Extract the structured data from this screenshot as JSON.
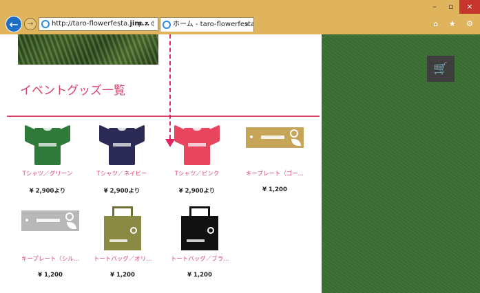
{
  "browser": {
    "address_url_prefix": "http://taro-flowerfesta.",
    "address_url_host": "jim...",
    "address_controls": "ρ ▾ ¢",
    "tab_title": "ホーム - taro-flowerfesta ...",
    "tab_close": "×",
    "back_icon": "arrow-left-icon",
    "window_minimize": "–",
    "window_restore": "▫",
    "window_close": "×",
    "toolbar_icons": "⌂ ★ ⚙"
  },
  "page": {
    "section_title": "イベントグッズ一覧",
    "accent_color": "#d9406a",
    "sidebar_color": "#3b6e34",
    "cart_icon": "cart-icon"
  },
  "products": [
    {
      "name": "Tシャツ／グリーン",
      "price": "¥ 2,900より",
      "kind": "tshirt",
      "color": "#2f7a3a"
    },
    {
      "name": "Tシャツ／ネイビー",
      "price": "¥ 2,900より",
      "kind": "tshirt",
      "color": "#2b2a55"
    },
    {
      "name": "Tシャツ／ピンク",
      "price": "¥ 2,900より",
      "kind": "tshirt",
      "color": "#e8455f"
    },
    {
      "name": "キープレート（ゴー...",
      "price": "¥ 1,200",
      "kind": "plate",
      "color": "#c6a558"
    },
    {
      "name": "キープレート（シル...",
      "price": "¥ 1,200",
      "kind": "plate",
      "color": "#b8b8b8"
    },
    {
      "name": "トートバッグ／オリ...",
      "price": "¥ 1,200",
      "kind": "tote",
      "color": "#8a8a45"
    },
    {
      "name": "トートバッグ／ブラ...",
      "price": "¥ 1,200",
      "kind": "tote",
      "color": "#111111"
    }
  ]
}
